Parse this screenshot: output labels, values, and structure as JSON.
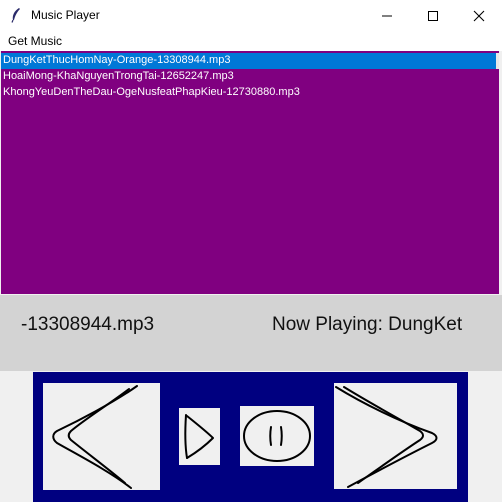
{
  "window": {
    "title": "Music Player",
    "icons": [
      "feather-icon",
      "minimize-icon",
      "maximize-icon",
      "close-icon"
    ]
  },
  "menu": {
    "items": [
      "Get Music"
    ]
  },
  "playlist": {
    "background": "#800080",
    "selected_color": "#0078d7",
    "tracks": [
      "DungKetThucHomNay-Orange-13308944.mp3",
      "HoaiMong-KhaNguyenTrongTai-12652247.mp3",
      "KhongYeuDenTheDau-OgeNusfeatPhapKieu-12730880.mp3"
    ],
    "selected_index": 0
  },
  "now_playing": {
    "left_text": "-13308944.mp3",
    "right_text": "Now Playing: DungKet"
  },
  "controls": {
    "background": "#000080",
    "buttons": [
      "previous-icon",
      "play-icon",
      "pause-icon",
      "next-icon"
    ]
  }
}
